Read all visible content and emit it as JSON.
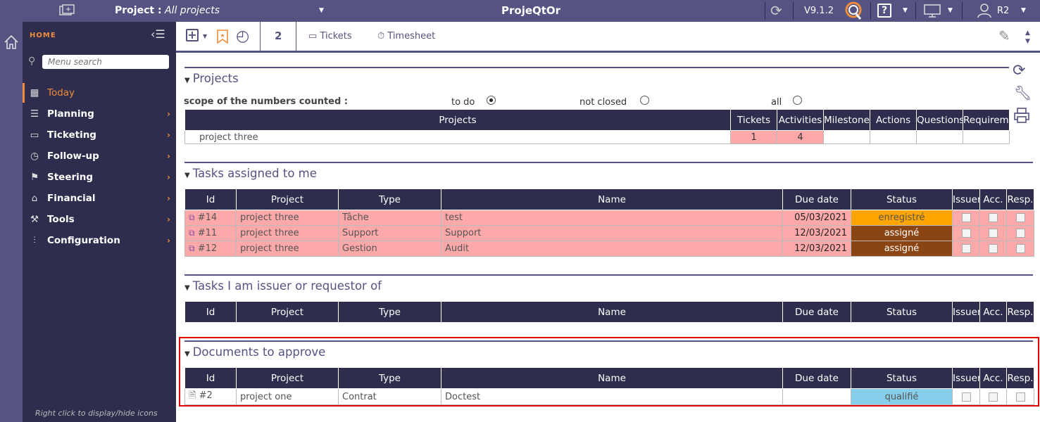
{
  "topbar": {
    "project_label": "Project :",
    "project_value": "All projects",
    "app_title": "ProjeQtOr",
    "version": "V9.1.2",
    "user": "R2",
    "colors": {
      "bg": "#545381",
      "dark": "#2e2d4d",
      "accent": "#f08c3a"
    }
  },
  "sidebar": {
    "home_label": "HOME",
    "search_placeholder": "Menu search",
    "items": [
      {
        "label": "Today",
        "icon": "calendar-icon",
        "active": true
      },
      {
        "label": "Planning",
        "icon": "planning-icon"
      },
      {
        "label": "Ticketing",
        "icon": "ticketing-icon"
      },
      {
        "label": "Follow-up",
        "icon": "follow-up-icon"
      },
      {
        "label": "Steering",
        "icon": "steering-icon"
      },
      {
        "label": "Financial",
        "icon": "bank-icon"
      },
      {
        "label": "Tools",
        "icon": "tools-icon"
      },
      {
        "label": "Configuration",
        "icon": "sliders-icon"
      }
    ],
    "footer_hint": "Right click to display/hide icons"
  },
  "toolbar": {
    "count": "2",
    "tickets_label": "Tickets",
    "timesheet_label": "Timesheet"
  },
  "projects_section": {
    "title": "Projects",
    "scope_label": "scope of the numbers counted :",
    "scope_options": [
      "to do",
      "not closed",
      "all"
    ],
    "scope_selected": "to do",
    "columns": [
      "Projects",
      "Tickets",
      "Activities",
      "Milestones",
      "Actions",
      "Questions",
      "Requirements"
    ],
    "rows": [
      {
        "project": "project three",
        "tickets": "1",
        "activities": "4",
        "milestones": "",
        "actions": "",
        "questions": "",
        "requirements": ""
      }
    ]
  },
  "tasks_assigned": {
    "title": "Tasks assigned to me",
    "columns": [
      "Id",
      "Project",
      "Type",
      "Name",
      "Due date",
      "Status",
      "Issuer",
      "Acc.",
      "Resp."
    ],
    "rows": [
      {
        "id": "#14",
        "project": "project three",
        "type": "Tâche",
        "name": "test",
        "due": "05/03/2021",
        "status": "enregistré",
        "status_color": "#ffa500"
      },
      {
        "id": "#11",
        "project": "project three",
        "type": "Support",
        "name": "Support",
        "due": "12/03/2021",
        "status": "assigné",
        "status_color": "#8b4513"
      },
      {
        "id": "#12",
        "project": "project three",
        "type": "Gestion",
        "name": "Audit",
        "due": "12/03/2021",
        "status": "assigné",
        "status_color": "#8b4513"
      }
    ]
  },
  "tasks_issuer": {
    "title": "Tasks I am issuer or requestor of",
    "columns": [
      "Id",
      "Project",
      "Type",
      "Name",
      "Due date",
      "Status",
      "Issuer",
      "Acc.",
      "Resp."
    ],
    "rows": []
  },
  "documents": {
    "title": "Documents to approve",
    "columns": [
      "Id",
      "Project",
      "Type",
      "Name",
      "Due date",
      "Status",
      "Issuer",
      "Acc.",
      "Resp."
    ],
    "rows": [
      {
        "id": "#2",
        "project": "project one",
        "type": "Contrat",
        "name": "Doctest",
        "due": "",
        "status": "qualifié",
        "status_color": "#87ceeb"
      }
    ]
  }
}
